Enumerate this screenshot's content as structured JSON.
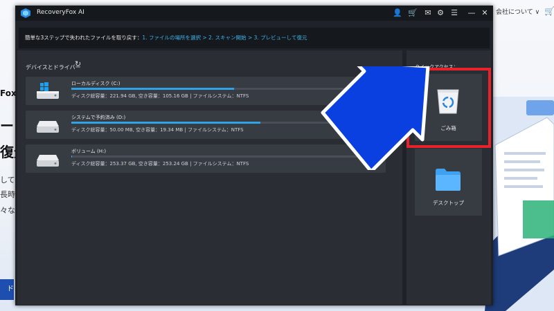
{
  "background": {
    "fox_text": "Fox",
    "big_line1": "ート",
    "big_line2": "復元",
    "lines": [
      "して",
      "長時",
      "々な"
    ],
    "button_text": "ド",
    "top_right_link": "会社について ∨"
  },
  "app": {
    "title": "RecoveryFox AI",
    "steps_lead": "簡単な3ステップで失われたファイルを取り戻す：",
    "step1": "1. ファイルの場所を選択",
    "step2": "2. スキャン開始",
    "step3": "3. プレビューして復元",
    "sep": " > "
  },
  "devices": {
    "title": "デバイスとドライバー",
    "drives": [
      {
        "name": "ローカルディスク (C:)",
        "info": "ディスク総容量：221.94 GB, 空き容量：105.16 GB | ファイルシステム：NTFS",
        "used_fraction": 0.526
      },
      {
        "name": "システムで予約済み (D:)",
        "info": "ディスク総容量：50.00 MB, 空き容量：19.34 MB | ファイルシステム：NTFS",
        "used_fraction": 0.613
      },
      {
        "name": "ボリューム (H:)",
        "info": "ディスク総容量：253.37 GB, 空き容量：253.24 GB | ファイルシステム：NTFS",
        "used_fraction": 0.001
      }
    ]
  },
  "quick_access": {
    "title": "クイックアクセス：",
    "items": [
      {
        "label": "ごみ箱"
      },
      {
        "label": "デスクトップ"
      }
    ]
  },
  "colors": {
    "accent": "#2fa3e6",
    "highlight": "#e8222a",
    "arrow": "#0a3fe0"
  }
}
